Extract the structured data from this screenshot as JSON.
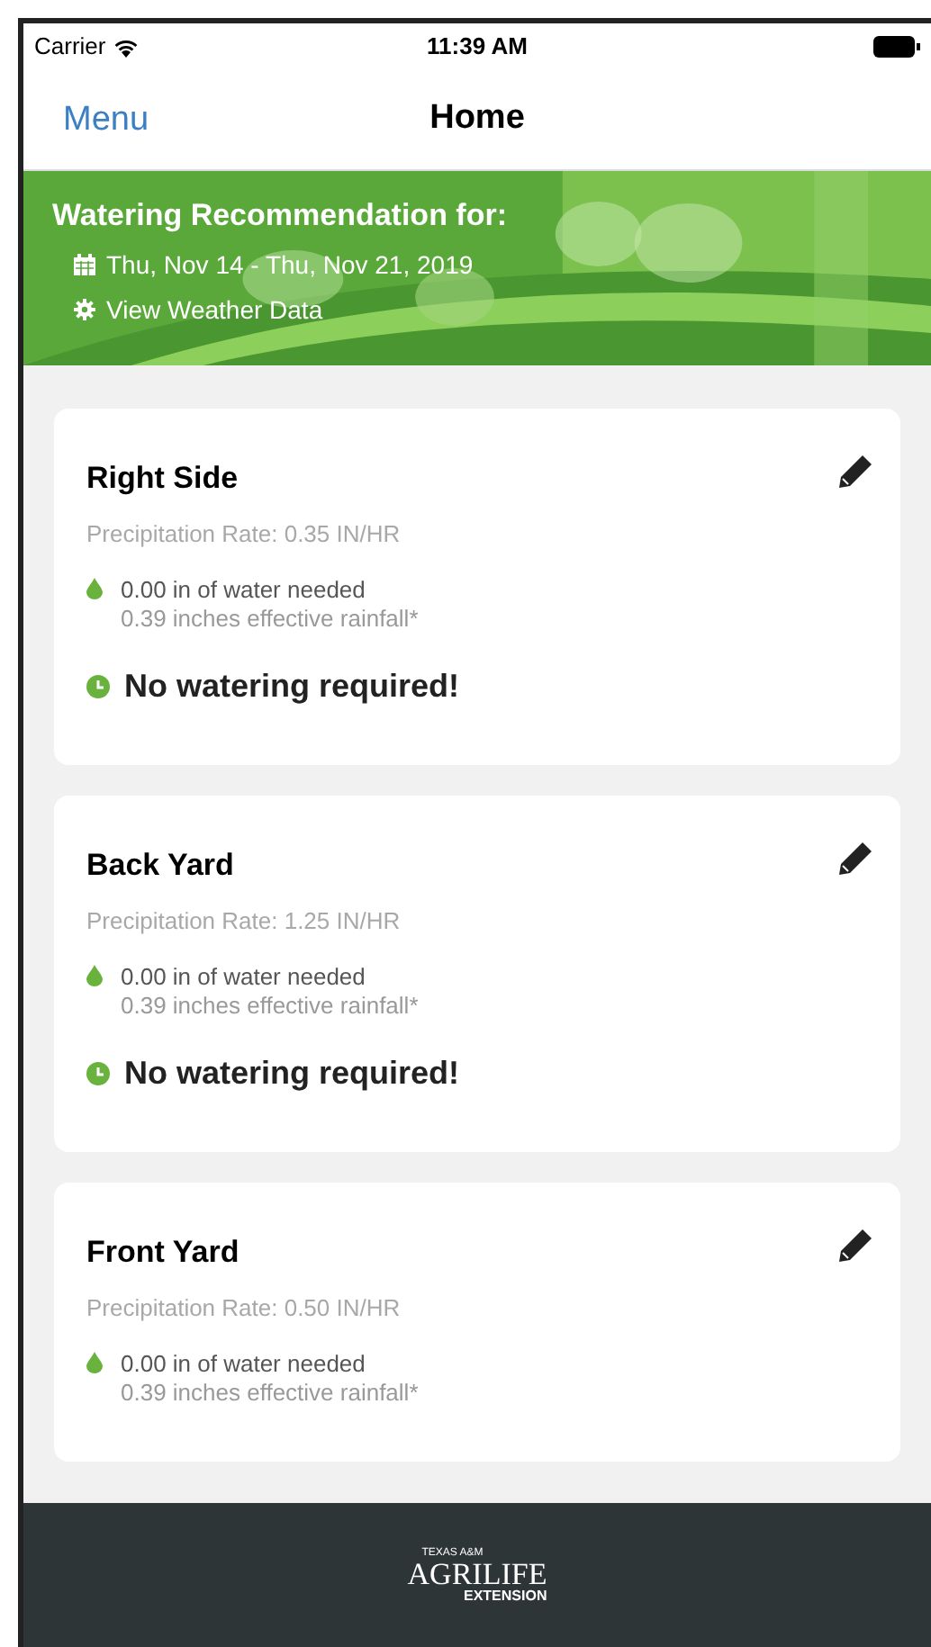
{
  "status_bar": {
    "carrier": "Carrier",
    "time": "11:39 AM"
  },
  "nav_bar": {
    "menu": "Menu",
    "title": "Home"
  },
  "banner": {
    "kind": "picture",
    "heading": "Watering Recommendation for:",
    "date_range": "Thu, Nov 14 - Thu, Nov 21, 2019",
    "weather_link": "View Weather Data"
  },
  "zones": [
    {
      "name": "Right Side",
      "precipitation_rate": "Precipitation Rate: 0.35 IN/HR",
      "water_needed": "0.00 in of water needed",
      "rainfall": "0.39 inches effective rainfall*",
      "status": "No watering required!"
    },
    {
      "name": "Back Yard",
      "precipitation_rate": "Precipitation Rate: 1.25 IN/HR",
      "water_needed": "0.00 in of water needed",
      "rainfall": "0.39 inches effective rainfall*",
      "status": "No watering required!"
    },
    {
      "name": "Front Yard",
      "precipitation_rate": "Precipitation Rate: 0.50 IN/HR",
      "water_needed": "0.00 in of water needed",
      "rainfall": "0.39 inches effective rainfall*"
    }
  ],
  "footer": {
    "logo_top": "TEXAS A&M",
    "logo_main": "AGRILIFE",
    "logo_bottom": "EXTENSION"
  }
}
